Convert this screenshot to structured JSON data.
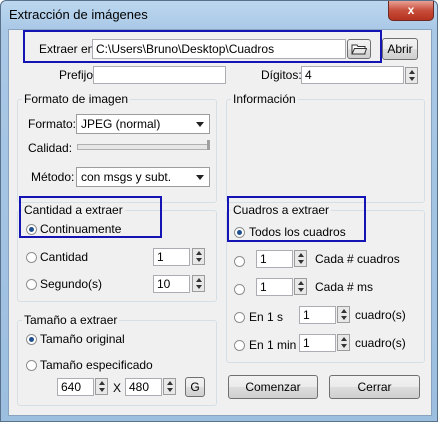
{
  "window": {
    "title": "Extracción de imágenes",
    "close_glyph": "x"
  },
  "top": {
    "extraer_label": "Extraer en:",
    "path_value": "C:\\Users\\Bruno\\Desktop\\Cuadros",
    "abrir_label": "Abrir",
    "prefijo_label": "Prefijo:",
    "prefijo_value": "",
    "digitos_label": "Dígitos:",
    "digitos_value": "4"
  },
  "formato_imagen": {
    "title": "Formato de imagen",
    "formato_label": "Formato:",
    "formato_value": "JPEG (normal)",
    "calidad_label": "Calidad:",
    "metodo_label": "Método:",
    "metodo_value": "con msgs y subt."
  },
  "informacion": {
    "title": "Información"
  },
  "cantidad": {
    "title": "Cantidad a extraer",
    "continuamente": "Continuamente",
    "cantidad_label": "Cantidad",
    "cantidad_value": "1",
    "segundos_label": "Segundo(s)",
    "segundos_value": "10"
  },
  "cuadros": {
    "title": "Cuadros a extraer",
    "todos": "Todos los cuadros",
    "cada_cuadros_value": "1",
    "cada_cuadros_label": "Cada # cuadros",
    "cada_ms_value": "1",
    "cada_ms_label": "Cada # ms",
    "en1s_label": "En 1 s",
    "en1s_value": "1",
    "en1s_unit": "cuadro(s)",
    "en1min_label": "En 1 min",
    "en1min_value": "1",
    "en1min_unit": "cuadro(s)"
  },
  "tamano": {
    "title": "Tamaño a extraer",
    "original": "Tamaño original",
    "especificado": "Tamaño especificado",
    "width_value": "640",
    "x_label": "X",
    "height_value": "480",
    "g_label": "G"
  },
  "actions": {
    "comenzar": "Comenzar",
    "cerrar": "Cerrar"
  },
  "colors": {
    "highlight": "#1414b4",
    "radio_dot": "#1f4f8f"
  }
}
